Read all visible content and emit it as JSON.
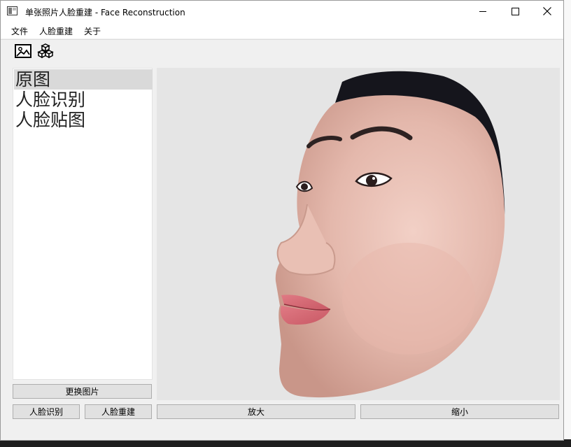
{
  "window": {
    "title": "单张照片人脸重建 - Face Reconstruction"
  },
  "menu": {
    "items": [
      "文件",
      "人脸重建",
      "关于"
    ]
  },
  "toolbar": {
    "icons": [
      "image-icon",
      "cubes-icon"
    ]
  },
  "list": {
    "items": [
      "原图",
      "人脸识别",
      "人脸贴图"
    ],
    "selected": "原图"
  },
  "buttons": {
    "change_image": "更换图片",
    "face_detect": "人脸识别",
    "face_reconstruct": "人脸重建",
    "zoom_in": "放大",
    "zoom_out": "缩小"
  },
  "colors": {
    "window_bg": "#f0f0f0",
    "list_selected": "#d9d9d9",
    "image_bg": "#e5e5e5"
  }
}
